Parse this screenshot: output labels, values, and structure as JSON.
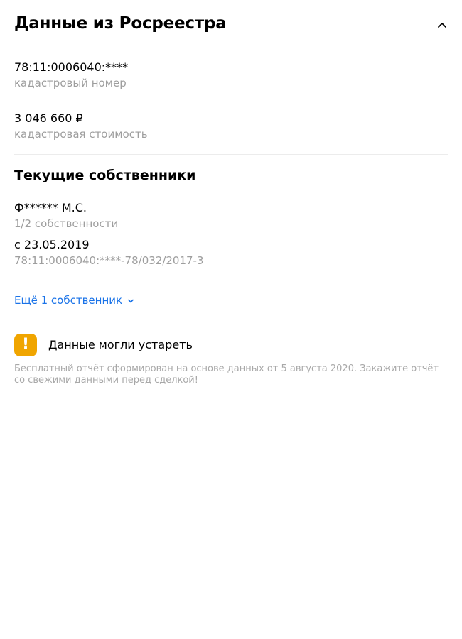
{
  "header": {
    "title": "Данные из Росреестра"
  },
  "cadastral": {
    "number": "78:11:0006040:****",
    "number_caption": "кадастровый номер",
    "value": "3 046 660 ₽",
    "value_caption": "кадастровая стоимость"
  },
  "owners": {
    "section_title": "Текущие собственники",
    "items": [
      {
        "name": "Ф****** М.С.",
        "share": "1/2 собственности",
        "since": "с 23.05.2019",
        "record": "78:11:0006040:****-78/032/2017-3"
      }
    ],
    "more_label": "Ещё 1 собственник"
  },
  "warning": {
    "icon_glyph": "!",
    "title": "Данные могли устареть",
    "note": "Бесплатный отчёт сформирован на основе данных от 5 августа 2020. Закажите отчёт со свежими данными перед сделкой!",
    "icon_color": "#f0a500"
  },
  "colors": {
    "link": "#1a73e8",
    "caption": "#9e9e9e",
    "divider": "#ececec"
  }
}
